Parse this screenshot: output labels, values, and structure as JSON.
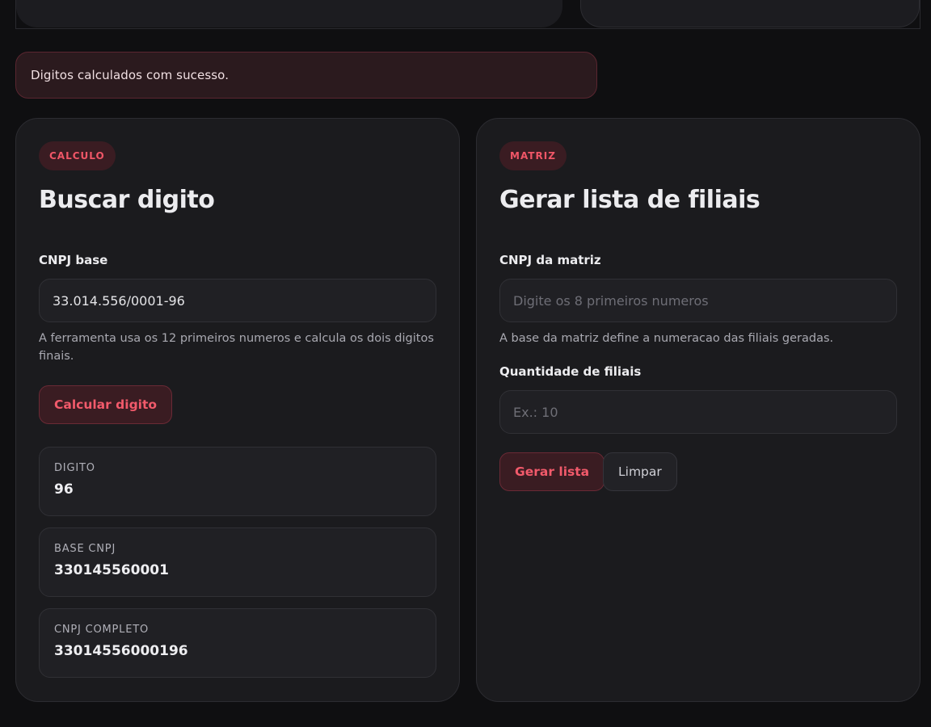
{
  "toast": {
    "message": "Digitos calculados com sucesso."
  },
  "left_card": {
    "badge": "CALCULO",
    "title": "Buscar digito",
    "field_label": "CNPJ base",
    "input_value": "33.014.556/0001-96",
    "helper": "A ferramenta usa os 12 primeiros numeros e calcula os dois digitos finais.",
    "button_label": "Calcular digito",
    "results": [
      {
        "label": "DIGITO",
        "value": "96"
      },
      {
        "label": "BASE CNPJ",
        "value": "330145560001"
      },
      {
        "label": "CNPJ COMPLETO",
        "value": "33014556000196"
      }
    ]
  },
  "right_card": {
    "badge": "MATRIZ",
    "title": "Gerar lista de filiais",
    "matrix_label": "CNPJ da matriz",
    "matrix_placeholder": "Digite os 8 primeiros numeros",
    "matrix_helper": "A base da matriz define a numeracao das filiais geradas.",
    "qty_label": "Quantidade de filiais",
    "qty_placeholder": "Ex.: 10",
    "generate_label": "Gerar lista",
    "clear_label": "Limpar"
  },
  "colors": {
    "accent": "#f05667",
    "background": "#0f0f11",
    "card": "#1b1b1e"
  }
}
